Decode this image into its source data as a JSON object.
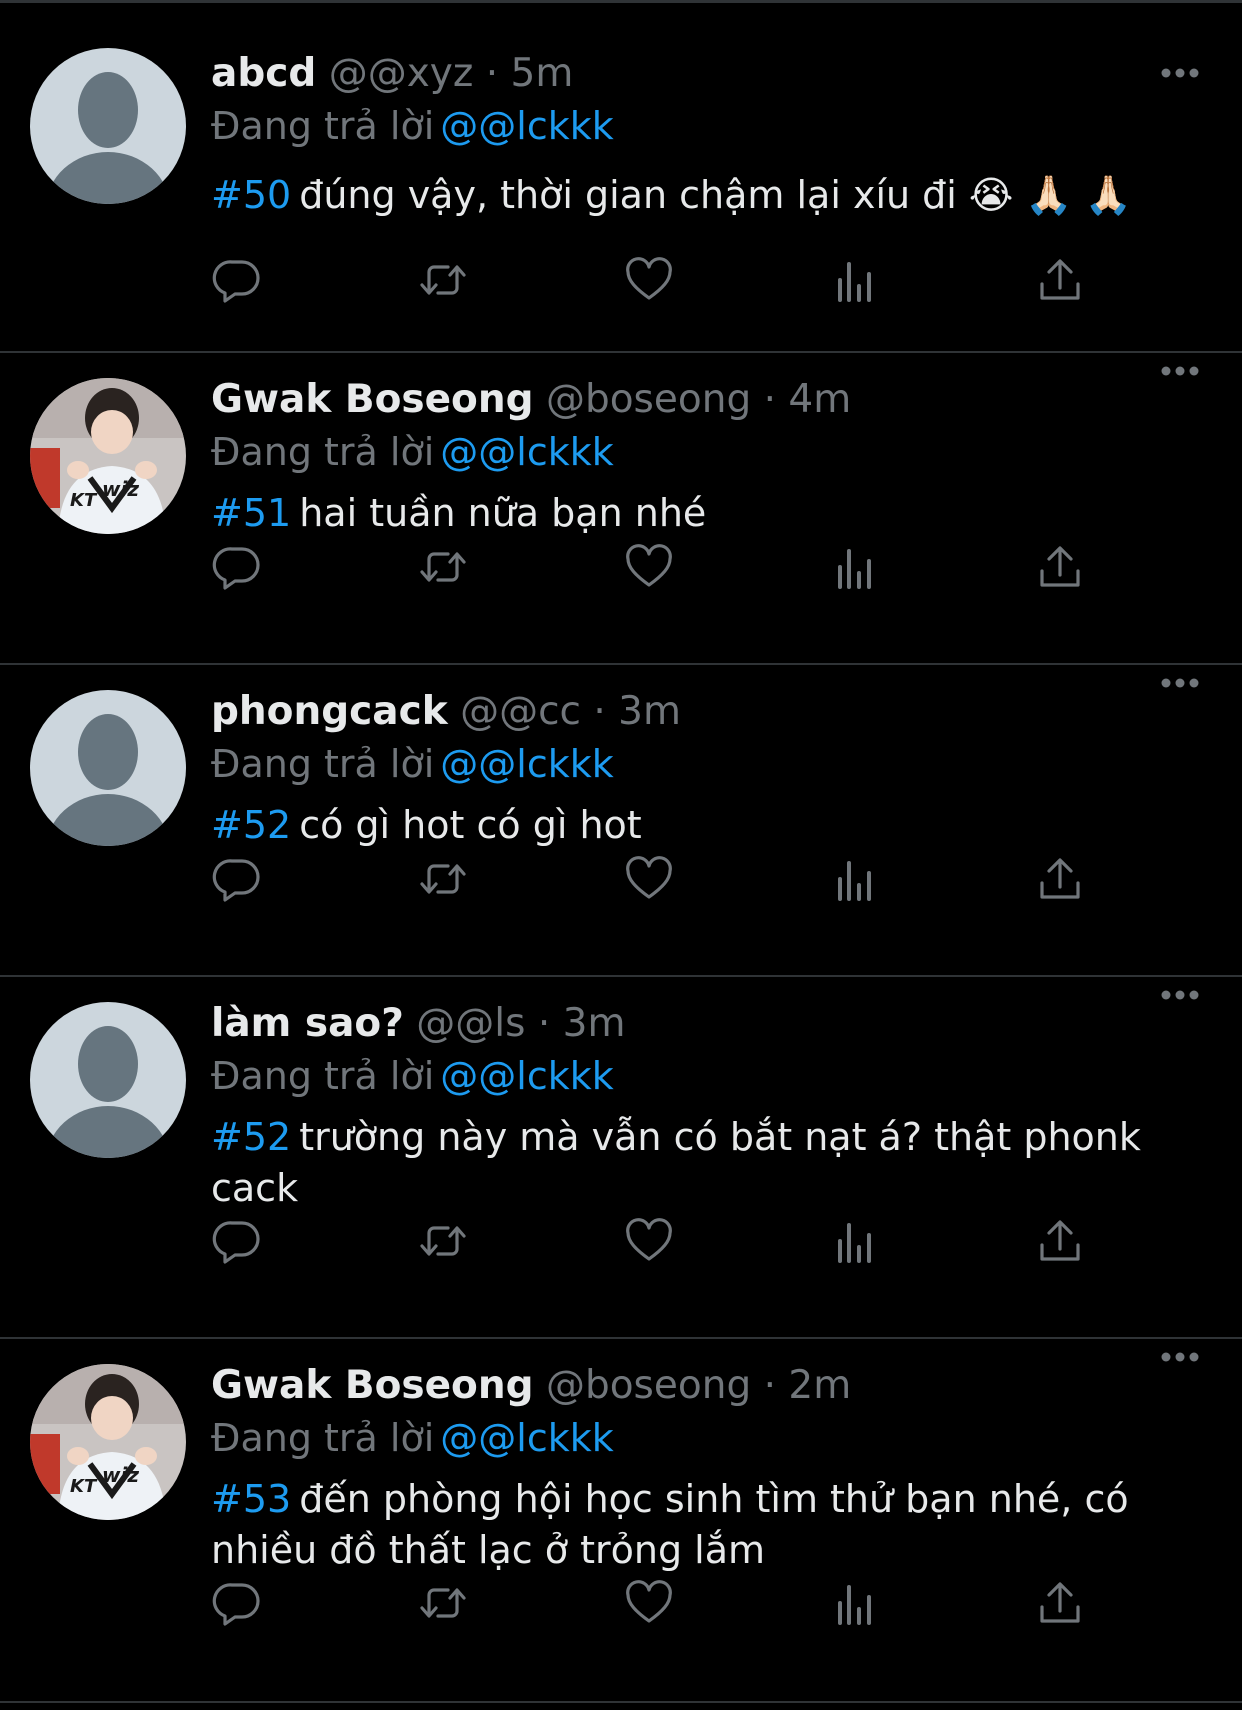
{
  "colors": {
    "background": "#000000",
    "text_primary": "#e7e9ea",
    "text_secondary": "#71767b",
    "accent": "#1d9bf0",
    "divider": "#2f3336",
    "icon": "#71767b"
  },
  "reply_prefix": "Đang trả lời",
  "tweets": [
    {
      "display_name": "abcd",
      "handle": "@@xyz",
      "separator": "·",
      "time": "5m",
      "reply_to": "@@lckkk",
      "hashtag": "#50",
      "text": "đúng vậy, thời gian chậm lại xíu đi 😭 🙏🏻 🙏🏻",
      "avatar": "default-avatar-icon"
    },
    {
      "display_name": "Gwak Boseong",
      "handle": "@boseong",
      "separator": "·",
      "time": "4m",
      "reply_to": "@@lckkk",
      "hashtag": "#51",
      "text": "hai tuần nữa bạn nhé",
      "avatar": "profile-photo"
    },
    {
      "display_name": "phongcack",
      "handle": "@@cc",
      "separator": "·",
      "time": "3m",
      "reply_to": "@@lckkk",
      "hashtag": "#52",
      "text": "có gì hot có gì hot",
      "avatar": "default-avatar-icon"
    },
    {
      "display_name": "làm sao?",
      "handle": "@@ls",
      "separator": "·",
      "time": "3m",
      "reply_to": "@@lckkk",
      "hashtag": "#52",
      "text": "trường này mà vẫn có bắt nạt á? thật phonk cack",
      "avatar": "default-avatar-icon"
    },
    {
      "display_name": "Gwak Boseong",
      "handle": "@boseong",
      "separator": "·",
      "time": "2m",
      "reply_to": "@@lckkk",
      "hashtag": "#53",
      "text": "đến phòng hội học sinh tìm thử bạn nhé, có nhiều đồ thất lạc ở trỏng lắm",
      "avatar": "profile-photo"
    }
  ],
  "action_icons": [
    "reply-icon",
    "retweet-icon",
    "like-icon",
    "views-icon",
    "share-icon"
  ]
}
